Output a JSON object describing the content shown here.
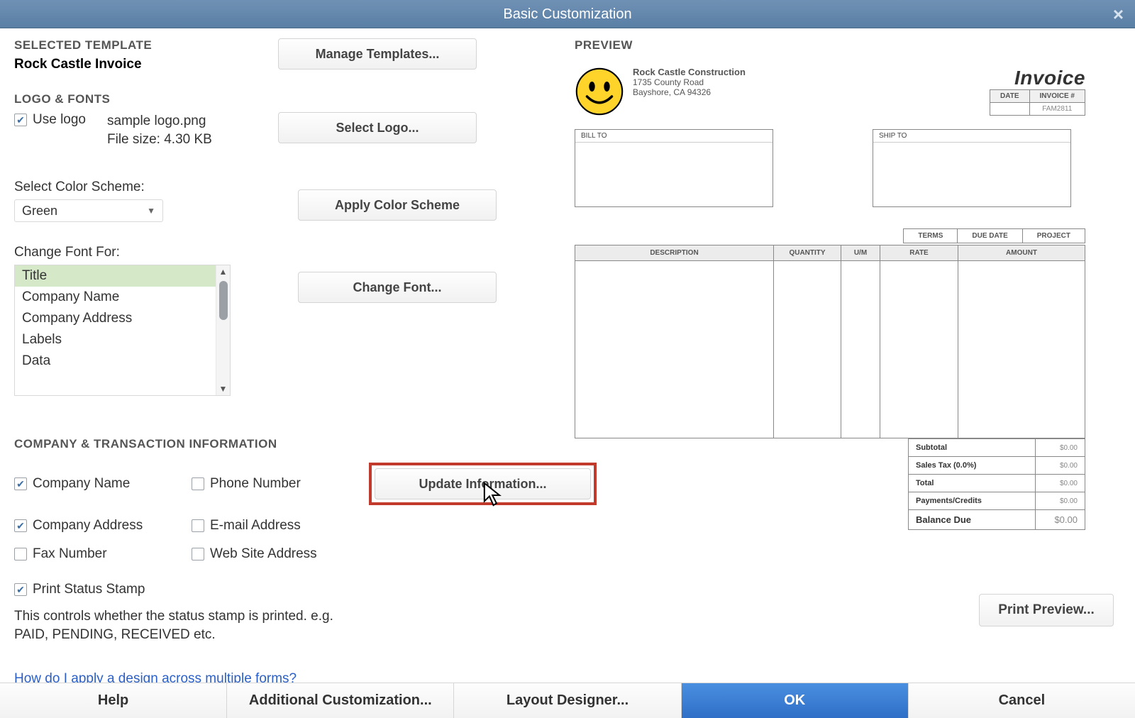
{
  "window": {
    "title": "Basic Customization"
  },
  "template": {
    "section_label": "SELECTED TEMPLATE",
    "name": "Rock Castle Invoice",
    "manage_btn": "Manage Templates..."
  },
  "logo": {
    "section_label": "LOGO & FONTS",
    "use_logo_label": "Use logo",
    "use_logo_checked": true,
    "file_name": "sample logo.png",
    "file_size_label": "File size: 4.30 KB",
    "select_btn": "Select Logo..."
  },
  "color": {
    "label": "Select Color Scheme:",
    "value": "Green",
    "apply_btn": "Apply Color Scheme"
  },
  "font": {
    "label": "Change Font For:",
    "items": [
      "Title",
      "Company Name",
      "Company Address",
      "Labels",
      "Data"
    ],
    "selected": "Title",
    "change_btn": "Change Font..."
  },
  "company_info": {
    "section_label": "COMPANY & TRANSACTION INFORMATION",
    "checks": {
      "company_name": {
        "label": "Company Name",
        "checked": true
      },
      "phone": {
        "label": "Phone Number",
        "checked": false
      },
      "company_addr": {
        "label": "Company Address",
        "checked": true
      },
      "email": {
        "label": "E-mail Address",
        "checked": false
      },
      "fax": {
        "label": "Fax Number",
        "checked": false
      },
      "website": {
        "label": "Web Site Address",
        "checked": false
      },
      "print_stamp": {
        "label": "Print Status Stamp",
        "checked": true
      }
    },
    "update_btn": "Update Information...",
    "status_note_1": "This controls whether the status stamp is printed. e.g.",
    "status_note_2": "PAID, PENDING, RECEIVED etc."
  },
  "help_link": "How do I apply a design across multiple forms?",
  "bottom": {
    "help": "Help",
    "additional": "Additional Customization...",
    "layout": "Layout Designer...",
    "ok": "OK",
    "cancel": "Cancel"
  },
  "preview": {
    "label": "PREVIEW",
    "company_name": "Rock Castle Construction",
    "address1": "1735 County Road",
    "address2": "Bayshore, CA 94326",
    "invoice_title": "Invoice",
    "date_hdr": "DATE",
    "inv_hdr": "INVOICE #",
    "inv_sample": "FAM2811",
    "bill_to": "BILL TO",
    "ship_to": "SHIP TO",
    "terms": "TERMS",
    "due_date": "DUE DATE",
    "project": "PROJECT",
    "col_desc": "DESCRIPTION",
    "col_qty": "QUANTITY",
    "col_um": "U/M",
    "col_rate": "RATE",
    "col_amt": "AMOUNT",
    "subtotal": "Subtotal",
    "salestax": "Sales Tax (0.0%)",
    "total": "Total",
    "payments": "Payments/Credits",
    "balance": "Balance Due",
    "zero": "$0.00",
    "print_btn": "Print Preview..."
  }
}
